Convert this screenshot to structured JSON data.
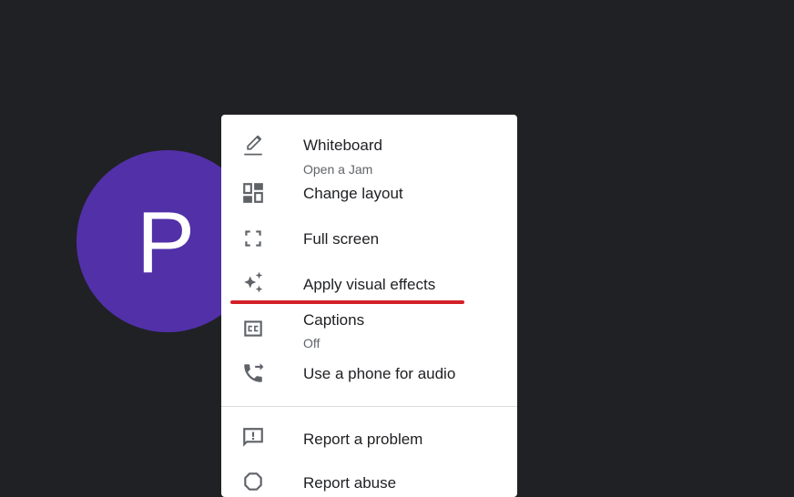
{
  "participant": {
    "initial": "P",
    "avatar_color": "#5230a8"
  },
  "menu": {
    "items": [
      {
        "label": "Whiteboard",
        "sublabel": "Open a Jam",
        "icon": "pencil-icon"
      },
      {
        "label": "Change layout",
        "icon": "layout-icon"
      },
      {
        "label": "Full screen",
        "icon": "fullscreen-icon"
      },
      {
        "label": "Apply visual effects",
        "icon": "sparkle-icon"
      },
      {
        "label": "Captions",
        "sublabel": "Off",
        "icon": "closed-captions-icon"
      },
      {
        "label": "Use a phone for audio",
        "icon": "phone-forward-icon"
      },
      {
        "label": "Report a problem",
        "icon": "feedback-icon"
      },
      {
        "label": "Report abuse",
        "icon": "report-icon"
      }
    ]
  },
  "annotation": {
    "underline_color": "#d32029",
    "underlined_item": "Apply visual effects"
  }
}
